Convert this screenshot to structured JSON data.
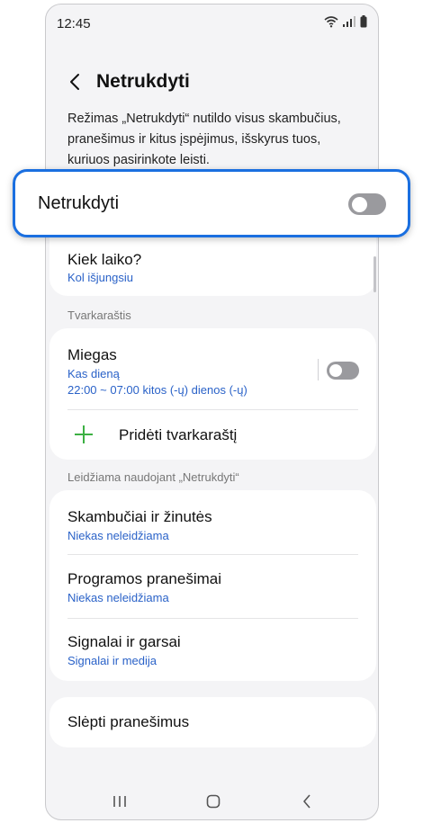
{
  "status_bar": {
    "time": "12:45"
  },
  "header": {
    "title": "Netrukdyti"
  },
  "description": "Režimas „Netrukdyti“ nutildo visus skambučius, pranešimus ir kitus įspėjimus, išskyrus tuos, kuriuos pasirinkote leisti.",
  "main_toggle": {
    "label": "Netrukdyti",
    "on": false
  },
  "duration": {
    "label": "Kiek laiko?",
    "value": "Kol išjungsiu"
  },
  "schedule_section": {
    "title": "Tvarkaraštis",
    "items": [
      {
        "label": "Miegas",
        "line1": "Kas dieną",
        "line2": "22:00 ~ 07:00 kitos (-ų) dienos (-ų)",
        "on": false
      }
    ],
    "add_label": "Pridėti tvarkaraštį"
  },
  "allowed_section": {
    "title": "Leidžiama naudojant „Netrukdyti“",
    "items": [
      {
        "label": "Skambučiai ir žinutės",
        "value": "Niekas neleidžiama"
      },
      {
        "label": "Programos pranešimai",
        "value": "Niekas neleidžiama"
      },
      {
        "label": "Signalai ir garsai",
        "value": "Signalai ir medija"
      }
    ]
  },
  "hide_notifications": {
    "label": "Slėpti pranešimus"
  },
  "colors": {
    "accent": "#1a6fe0",
    "link": "#2a62c8",
    "add_icon": "#3cb043",
    "background": "#f4f4f6"
  },
  "icons": {
    "wifi": "wifi-icon",
    "signal": "signal-icon",
    "battery": "battery-icon",
    "back": "chevron-left-icon",
    "add": "plus-icon",
    "recents": "recents-icon",
    "home": "home-icon",
    "nav_back": "nav-back-icon"
  }
}
